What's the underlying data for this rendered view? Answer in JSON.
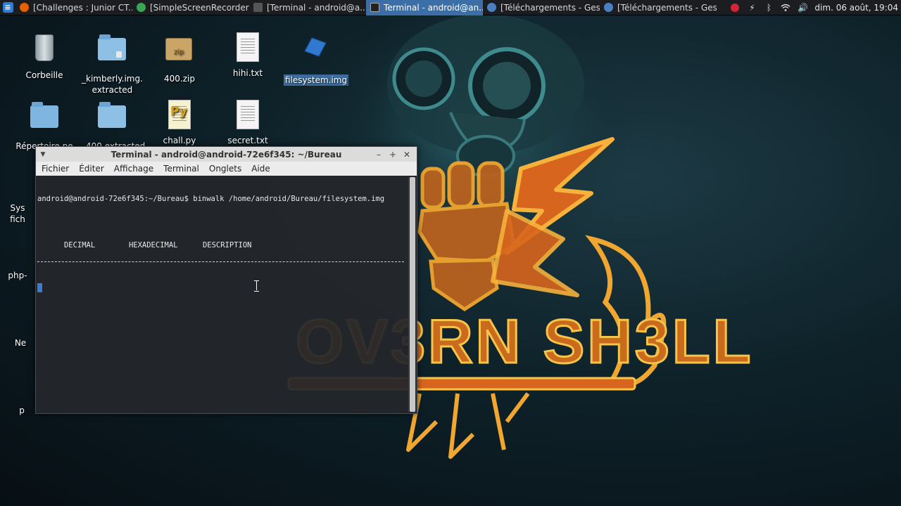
{
  "taskbar": {
    "tasks": [
      {
        "label": "[Challenges : Junior CT...",
        "icon": "firefox-icon",
        "color": "#e66000"
      },
      {
        "label": "[SimpleScreenRecorder]",
        "icon": "screen-recorder-icon",
        "color": "#3aa655"
      },
      {
        "label": "[Terminal - android@a...",
        "icon": "terminal-icon",
        "color": "#555555"
      },
      {
        "label": "Terminal - android@an...",
        "icon": "terminal-icon",
        "color": "#555555",
        "active": true
      },
      {
        "label": "[Téléchargements - Ges...",
        "icon": "download-manager-icon",
        "color": "#4a7fc1"
      },
      {
        "label": "[Téléchargements - Ges...",
        "icon": "download-manager-icon",
        "color": "#4a7fc1"
      }
    ],
    "tray_icons": [
      "record-icon",
      "power-icon",
      "bluetooth-icon",
      "wifi-icon",
      "volume-icon"
    ],
    "clock": "dim. 06 août, 19:04"
  },
  "desktop": {
    "icons": [
      {
        "label": "Corbeille",
        "icon": "trash-icon"
      },
      {
        "label": "_kimberly.img. extracted",
        "icon": "locked-folder-icon"
      },
      {
        "label": "400.zip",
        "icon": "zip-archive-icon"
      },
      {
        "label": "hihi.txt",
        "icon": "text-file-icon"
      },
      {
        "label": "filesystem.img",
        "icon": "disk-image-icon",
        "selected": true
      },
      {
        "label": "Répertoire pe",
        "icon": "home-folder-icon"
      },
      {
        "label": "_400.extracted",
        "icon": "folder-icon"
      },
      {
        "label": "chall.py",
        "icon": "python-file-icon"
      },
      {
        "label": "secret.txt",
        "icon": "text-file-icon"
      },
      {
        "label": "Sys fich",
        "icon": "drive-icon"
      },
      {
        "label": "php-",
        "icon": "folder-icon"
      },
      {
        "label": "Ne",
        "icon": "folder-icon"
      },
      {
        "label": "p",
        "icon": "folder-icon"
      }
    ]
  },
  "terminal": {
    "title": "Terminal - android@android-72e6f345: ~/Bureau",
    "menu": [
      "Fichier",
      "Éditer",
      "Affichage",
      "Terminal",
      "Onglets",
      "Aide"
    ],
    "prompt_line": "android@android-72e6f345:~/Bureau$ binwalk /home/android/Bureau/filesystem.img",
    "columns": [
      "DECIMAL",
      "HEXADECIMAL",
      "DESCRIPTION"
    ]
  },
  "wallpaper": {
    "text": "OV3RN SH3LL"
  },
  "colors": {
    "panel_bg": "#1b1d20",
    "active_task": "#3c6fa8",
    "wallpaper_logo": "#e8a02a",
    "wallpaper_glow": "#c0391b",
    "selection": "#3d6c9c"
  }
}
